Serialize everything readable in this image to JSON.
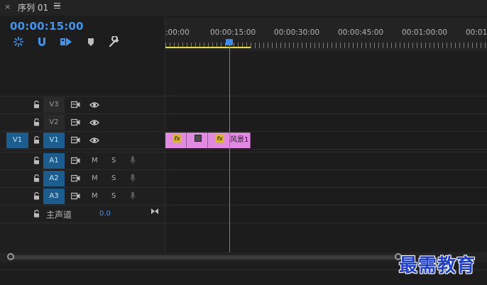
{
  "titlebar": {
    "close": "×",
    "title": "序列 01"
  },
  "timecode": "00:00:15:00",
  "ruler": {
    "labels": [
      ":00:00",
      "00:00:15:00",
      "00:00:30:00",
      "00:00:45:00",
      "00:01:00:00",
      "00:01:1"
    ]
  },
  "tracks": {
    "video": [
      {
        "name": "V3"
      },
      {
        "name": "V2"
      },
      {
        "name": "V1",
        "source": "V1"
      }
    ],
    "audio": [
      {
        "name": "A1",
        "mute": "M",
        "solo": "S"
      },
      {
        "name": "A2",
        "mute": "M",
        "solo": "S"
      },
      {
        "name": "A3",
        "mute": "M",
        "solo": "S"
      }
    ],
    "master": {
      "label": "主声道",
      "value": "0.0"
    }
  },
  "clips": [
    {
      "fx": "fx"
    },
    {
      "fx": ""
    },
    {
      "fx": "fx",
      "name": "风景1"
    }
  ],
  "watermark": "最需教育",
  "colors": {
    "accent": "#3b96f3",
    "clip": "#e28ae2",
    "workarea": "#e6df2e",
    "target": "#1b5d8f"
  }
}
